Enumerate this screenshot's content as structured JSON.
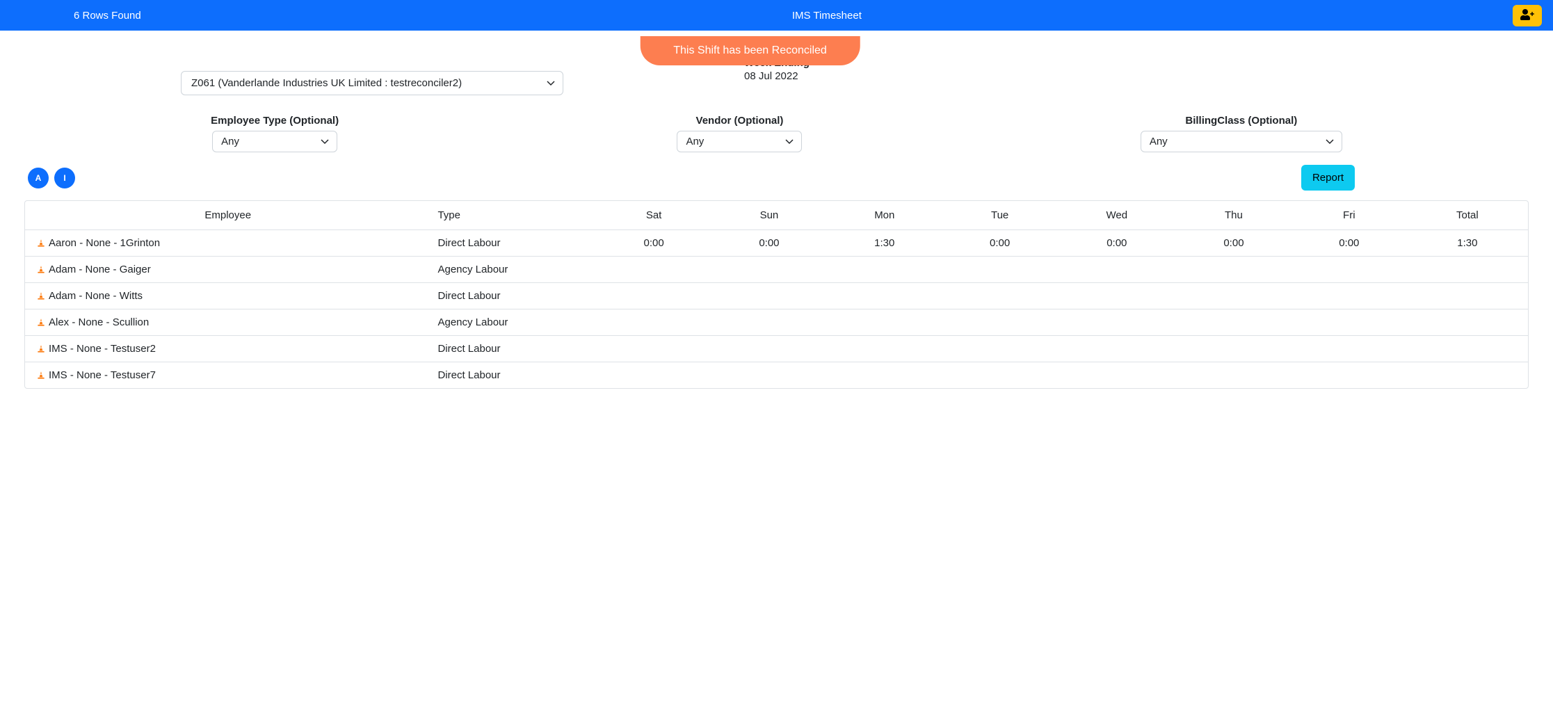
{
  "header": {
    "rows_found": "6 Rows Found",
    "title": "IMS Timesheet"
  },
  "toast": {
    "message": "This Shift has been Reconciled"
  },
  "project": {
    "selected": "Z061 (Vanderlande Industries UK Limited : testreconciler2)"
  },
  "week_ending": {
    "label": "Week Ending",
    "value": "08 Jul 2022"
  },
  "filters": {
    "employee_type": {
      "label": "Employee Type (Optional)",
      "value": "Any"
    },
    "vendor": {
      "label": "Vendor (Optional)",
      "value": "Any"
    },
    "billing_class": {
      "label": "BillingClass (Optional)",
      "value": "Any"
    }
  },
  "buttons": {
    "a": "A",
    "i": "I",
    "report": "Report"
  },
  "table": {
    "headers": [
      "Employee",
      "Type",
      "Sat",
      "Sun",
      "Mon",
      "Tue",
      "Wed",
      "Thu",
      "Fri",
      "Total"
    ],
    "rows": [
      {
        "employee": "Aaron - None - 1Grinton",
        "type": "Direct Labour",
        "sat": "0:00",
        "sun": "0:00",
        "mon": "1:30",
        "tue": "0:00",
        "wed": "0:00",
        "thu": "0:00",
        "fri": "0:00",
        "total": "1:30"
      },
      {
        "employee": "Adam - None - Gaiger",
        "type": "Agency Labour",
        "sat": "",
        "sun": "",
        "mon": "",
        "tue": "",
        "wed": "",
        "thu": "",
        "fri": "",
        "total": ""
      },
      {
        "employee": "Adam - None - Witts",
        "type": "Direct Labour",
        "sat": "",
        "sun": "",
        "mon": "",
        "tue": "",
        "wed": "",
        "thu": "",
        "fri": "",
        "total": ""
      },
      {
        "employee": "Alex - None - Scullion",
        "type": "Agency Labour",
        "sat": "",
        "sun": "",
        "mon": "",
        "tue": "",
        "wed": "",
        "thu": "",
        "fri": "",
        "total": ""
      },
      {
        "employee": "IMS - None - Testuser2",
        "type": "Direct Labour",
        "sat": "",
        "sun": "",
        "mon": "",
        "tue": "",
        "wed": "",
        "thu": "",
        "fri": "",
        "total": ""
      },
      {
        "employee": "IMS - None - Testuser7",
        "type": "Direct Labour",
        "sat": "",
        "sun": "",
        "mon": "",
        "tue": "",
        "wed": "",
        "thu": "",
        "fri": "",
        "total": ""
      }
    ]
  }
}
